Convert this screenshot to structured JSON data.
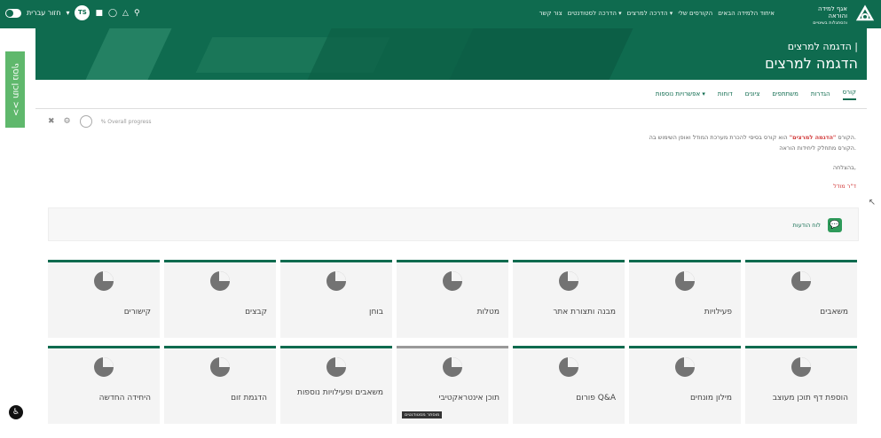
{
  "topbar": {
    "brand_line1": "אגף למידה",
    "brand_line2": "והוראה",
    "brand_line3": "והסתגלות בשינויים",
    "nav": [
      "איחוד הלמידה הבאים",
      "הקורסים שלי",
      "הדרכה למרצים ▾",
      "הדרכה לסטודנטים ▾",
      "צור קשר"
    ],
    "lang": "חזור עברית",
    "user_initials": "TS"
  },
  "banner": {
    "title_small": "הדגמה למרצים |",
    "title_large": "הדגמה למרצים"
  },
  "side_tab": {
    "label": "תוכן נוסף >>"
  },
  "tabs": [
    "קורס",
    "הגדרות",
    "משתתפים",
    "ציונים",
    "דוחות",
    "אפשרויות נוספות ▾"
  ],
  "controls": {
    "progress_label": "% Overall progress"
  },
  "description": {
    "line1_pre": "הקורס ",
    "line1_highlight": "\"הדגמה למרצים\"",
    "line1_post": " הוא קורס בסיסי להכרת מערכת המודל ואופן השימוש בה.",
    "line2": "הקורס מתחלק ליחידות הוראה.",
    "greeting": "בהצלחה,",
    "signature": "ד\"ר מודל"
  },
  "forum": {
    "label": "לוח הודעות"
  },
  "cards_row1": [
    "משאבים",
    "פעילויות",
    "מבנה ותצורת אתר",
    "מטלות",
    "בוחן",
    "קבצים",
    "קישורים"
  ],
  "cards_row2": [
    "הוספת דף תוכן מעוצב",
    "מילון מונחים",
    "פורום Q&A",
    "תוכן אינטראקטיבי",
    "משאבים ופעילויות נוספות",
    "הדגמת זום",
    "היחידה החדשה"
  ],
  "badge": "מוסתר מסטודנטים"
}
